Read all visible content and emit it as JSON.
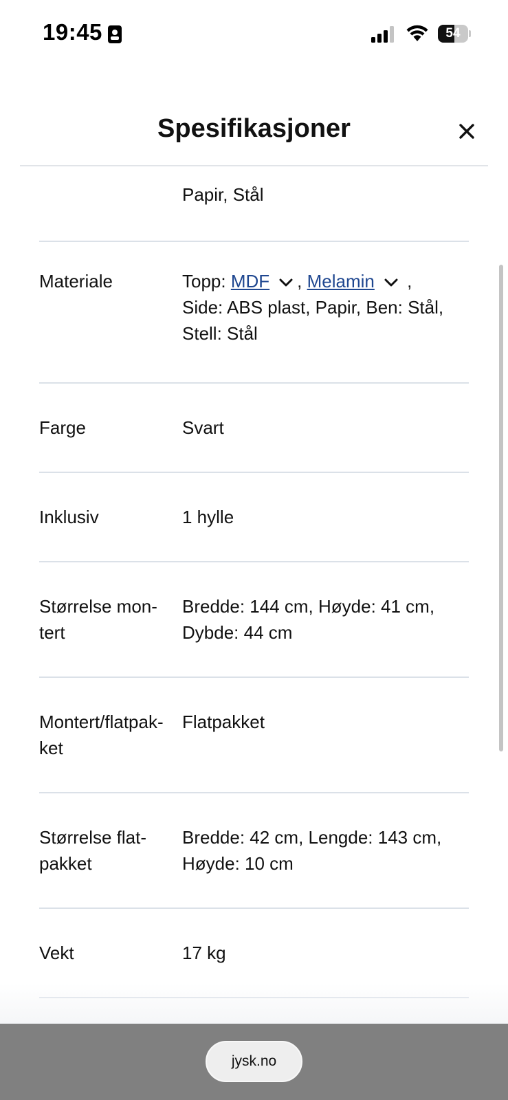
{
  "status_bar": {
    "time": "19:45",
    "battery_level": "54",
    "icons": [
      "focus-contact-icon",
      "cellular-signal-icon",
      "wifi-icon",
      "battery-icon"
    ]
  },
  "header": {
    "title": "Spesifikasjoner",
    "close_icon": "close-icon"
  },
  "specs": {
    "partial_row": {
      "value": "Papir, Stål"
    },
    "material": {
      "label": "Materiale",
      "prefix": "Topp: ",
      "link1": "MDF",
      "sep": ", ",
      "link2": "Melamin",
      "trail": " ,",
      "line2": "Side: ABS plast, Papir, Ben: Stål,",
      "line3": "Stell: Stål"
    },
    "color": {
      "label": "Farge",
      "value": "Svart"
    },
    "included": {
      "label": "Inklusiv",
      "value": "1 hylle"
    },
    "size_assembled": {
      "label_line1": "Størrelse mon-",
      "label_line2": "tert",
      "value_line1": "Bredde: 144 cm, Høyde: 41 cm,",
      "value_line2": "Dybde: 44 cm"
    },
    "assembled_flatpacked": {
      "label_line1": "Montert/flatpak-",
      "label_line2": "ket",
      "value": "Flatpakket"
    },
    "size_flatpacked": {
      "label_line1": "Størrelse flat-",
      "label_line2": "pakket",
      "value_line1": "Bredde: 42 cm, Lengde: 143 cm,",
      "value_line2": "Høyde: 10 cm"
    },
    "weight": {
      "label": "Vekt",
      "value": "17 kg"
    }
  },
  "browser": {
    "url": "jysk.no"
  },
  "colors": {
    "link": "#1f4790",
    "divider": "#dbe1e8",
    "bottom_bar": "#808080"
  }
}
